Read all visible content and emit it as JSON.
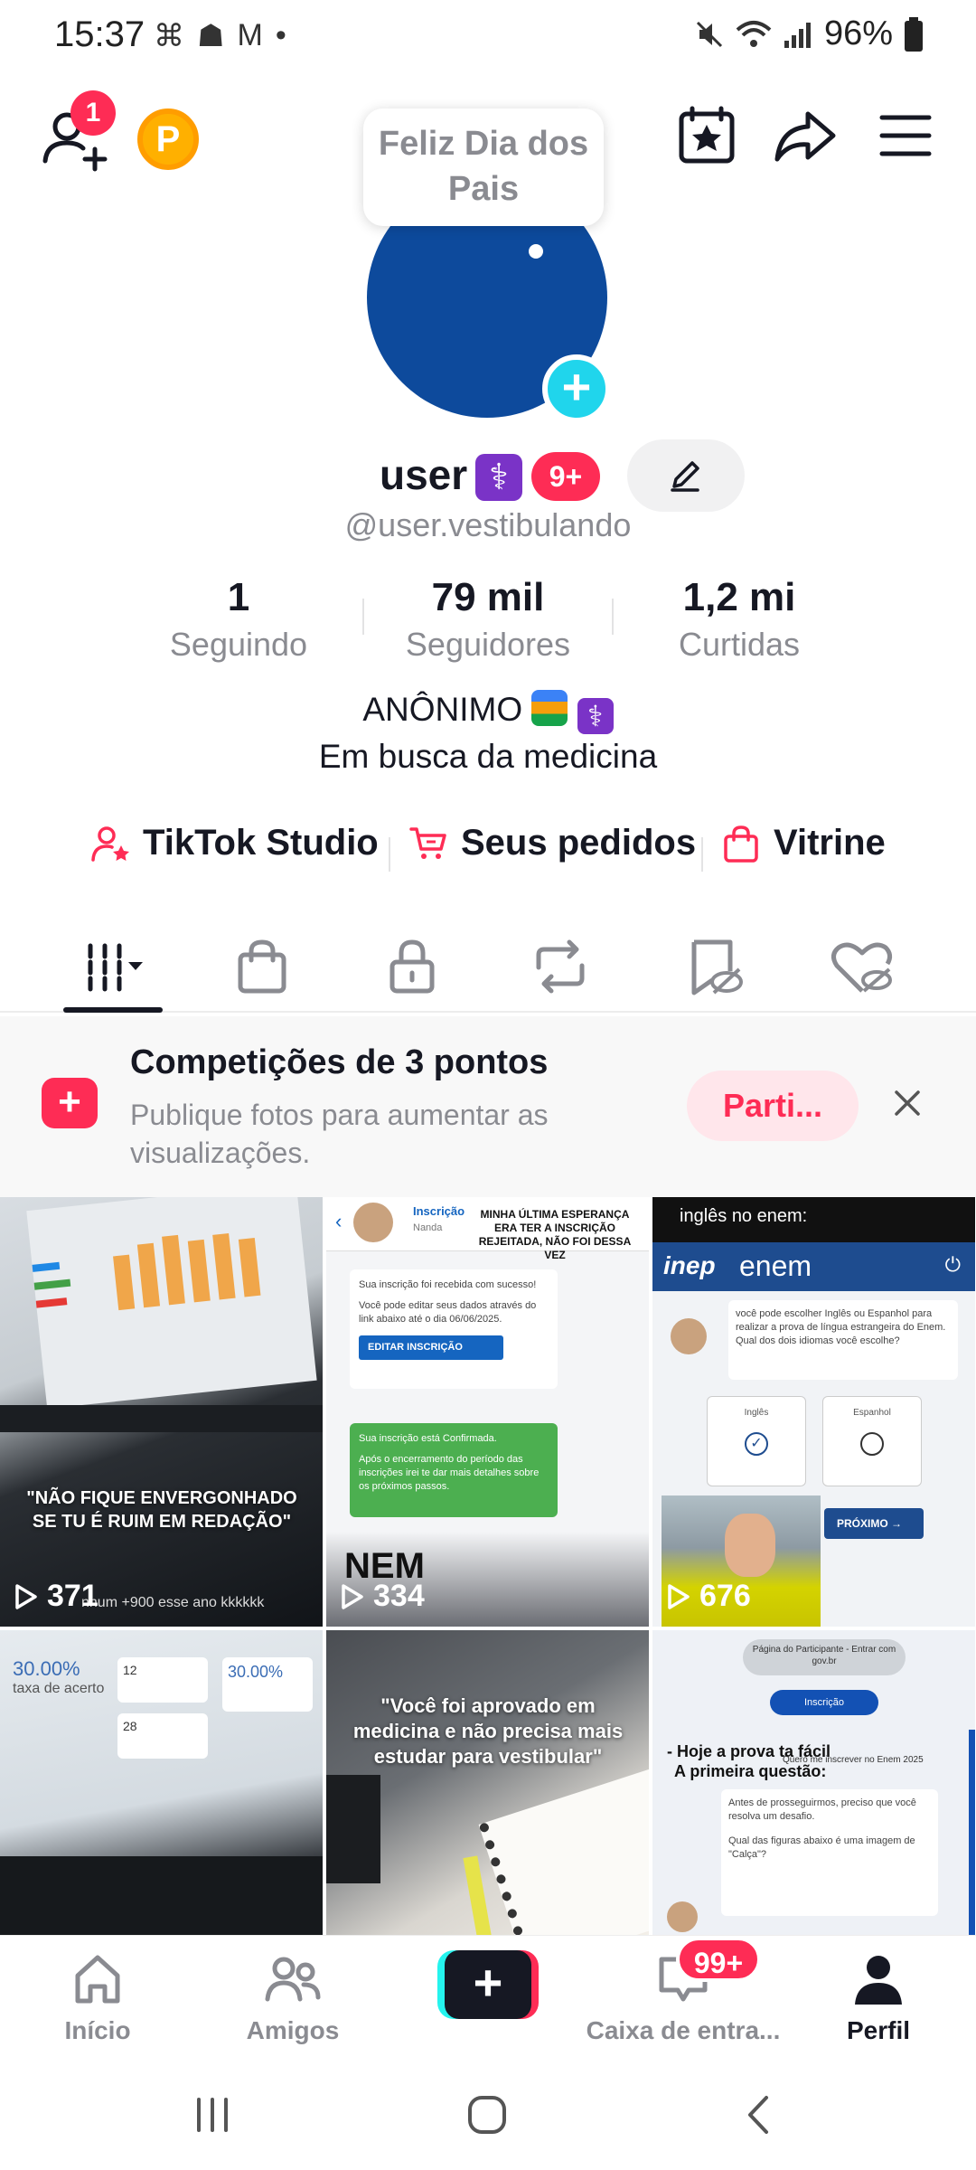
{
  "status_bar": {
    "time": "15:37",
    "battery": "96%",
    "notification_icons": [
      "teams-icon",
      "discord-icon",
      "gmail-icon",
      "dot-icon"
    ]
  },
  "top_bar": {
    "friend_badge": "1",
    "coin_letter": "P"
  },
  "profile": {
    "tooltip": "Feliz Dia dos Pais",
    "username": "user",
    "level_badge": "9+",
    "handle": "@user.vestibulando",
    "avatar_color": "#0d4a9c"
  },
  "stats": [
    {
      "value": "1",
      "label": "Seguindo"
    },
    {
      "value": "79 mil",
      "label": "Seguidores"
    },
    {
      "value": "1,2 mi",
      "label": "Curtidas"
    }
  ],
  "bio": {
    "line1": "ANÔNIMO",
    "line2": "Em busca da medicina"
  },
  "links": [
    {
      "label": "TikTok Studio",
      "icon": "user-star-icon"
    },
    {
      "label": "Seus pedidos",
      "icon": "cart-icon"
    },
    {
      "label": "Vitrine",
      "icon": "bag-icon"
    }
  ],
  "tabs": [
    "videos-grid",
    "shop",
    "private",
    "reposts",
    "favorites",
    "liked"
  ],
  "banner": {
    "title": "Competições de 3 pontos",
    "description": "Publique fotos para aumentar as visualizações.",
    "button": "Parti..."
  },
  "videos": [
    {
      "views": "371",
      "caption": "\"NÃO FIQUE ENVERGONHADO SE TU É RUIM EM REDAÇÃO\"",
      "small": "nhum +900 esse ano kkkkkk"
    },
    {
      "views": "334",
      "caption": "NEM",
      "header": "Inscrição",
      "sub": "Nanda",
      "title": "MINHA ÚLTIMA ESPERANÇA ERA TER A INSCRIÇÃO REJEITADA, NÃO FOI DESSA VEZ",
      "msg1": "Sua inscrição foi recebida com sucesso!",
      "msg2": "Você pode editar seus dados através do link abaixo até o dia 06/06/2025.",
      "btn": "EDITAR INSCRIÇÃO",
      "msg3": "Sua inscrição está Confirmada.",
      "msg4": "Após o encerramento do período das inscrições irei te dar mais detalhes sobre os próximos passos."
    },
    {
      "views": "676",
      "top": "inglês no enem:",
      "brand": "enem",
      "inep": "inep",
      "question": "você pode escolher Inglês ou Espanhol para realizar a prova de língua estrangeira do Enem. Qual dos dois idiomas você escolhe?",
      "opt1": "Inglês",
      "opt2": "Espanhol",
      "next": "PRÓXIMO"
    },
    {
      "pct": "30.00%",
      "pct_label": "taxa de acerto",
      "n1": "12",
      "n2": "28"
    },
    {
      "caption": "\"Você foi aprovado em medicina e não precisa mais estudar para vestibular\""
    },
    {
      "btn1": "Página do Participante - Entrar com gov.br",
      "btn2": "Inscrição",
      "line1": "- Hoje a prova ta fácil",
      "line2": "A primeira questão:",
      "small": "Quero me inscrever no Enem 2025",
      "q1": "Antes de prosseguirmos, preciso que você resolva um desafio.",
      "q2": "Qual das figuras abaixo é uma imagem de \"Calça\"?"
    }
  ],
  "bottom_nav": [
    {
      "label": "Início"
    },
    {
      "label": "Amigos"
    },
    {
      "label": ""
    },
    {
      "label": "Caixa de entra..."
    },
    {
      "label": "Perfil"
    }
  ],
  "inbox_badge": "99+",
  "colors": {
    "accent": "#fe2c55",
    "cyan": "#25f4ee",
    "text": "#161823",
    "muted": "#8a8b91"
  }
}
